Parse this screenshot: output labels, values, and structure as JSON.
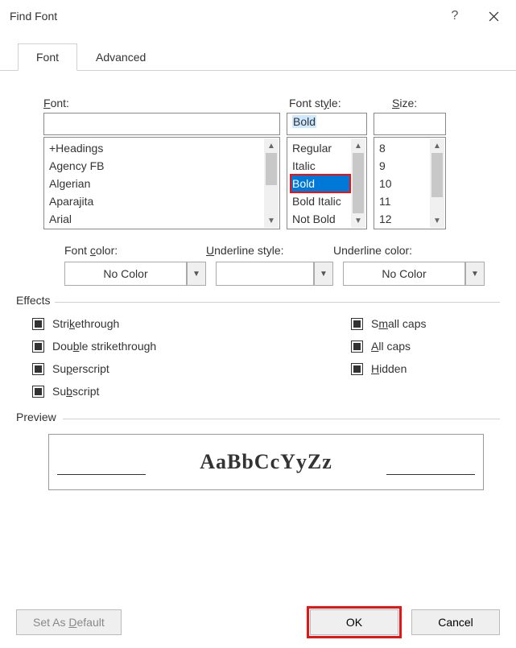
{
  "title": "Find Font",
  "tabs": {
    "font": "Font",
    "advanced": "Advanced"
  },
  "labels": {
    "font": "Font:",
    "style": "Font style:",
    "size": "Size:",
    "font_accesskey": "F",
    "style_text_after": " style:",
    "size_accesskey": "S",
    "size_text_after": "ize:",
    "font_color": "Font color:",
    "underline_style": "Underline style:",
    "underline_style_k": "U",
    "underline_style_after": "nderline style:",
    "underline_color": "Underline color:"
  },
  "inputs": {
    "font_value": "",
    "style_value": "Bold",
    "size_value": ""
  },
  "font_list": [
    "+Headings",
    "Agency FB",
    "Algerian",
    "Aparajita",
    "Arial"
  ],
  "style_list": [
    "Regular",
    "Italic",
    "Bold",
    "Bold Italic",
    "Not Bold"
  ],
  "style_selected_index": 2,
  "size_list": [
    "8",
    "9",
    "10",
    "11",
    "12"
  ],
  "dropdowns": {
    "font_color": "No Color",
    "underline_style": "",
    "underline_color": "No Color"
  },
  "effects_legend": "Effects",
  "effects_left": [
    {
      "k": "",
      "t": "Stri",
      "u": "k",
      "a": "ethrough"
    },
    {
      "k": "",
      "t": "Dou",
      "u": "b",
      "a": "le strikethrough"
    },
    {
      "k": "",
      "t": "Su",
      "u": "p",
      "a": "erscript"
    },
    {
      "k": "",
      "t": "Su",
      "u": "b",
      "a": "script"
    }
  ],
  "effects_right": [
    {
      "k": "",
      "t": "S",
      "u": "m",
      "a": "all caps"
    },
    {
      "k": "",
      "t": "",
      "u": "A",
      "a": "ll caps"
    },
    {
      "k": "",
      "t": "",
      "u": "H",
      "a": "idden"
    }
  ],
  "preview_legend": "Preview",
  "preview_text": "AaBbCcYyZz",
  "buttons": {
    "default": "Set As Default",
    "ok": "OK",
    "cancel": "Cancel"
  }
}
